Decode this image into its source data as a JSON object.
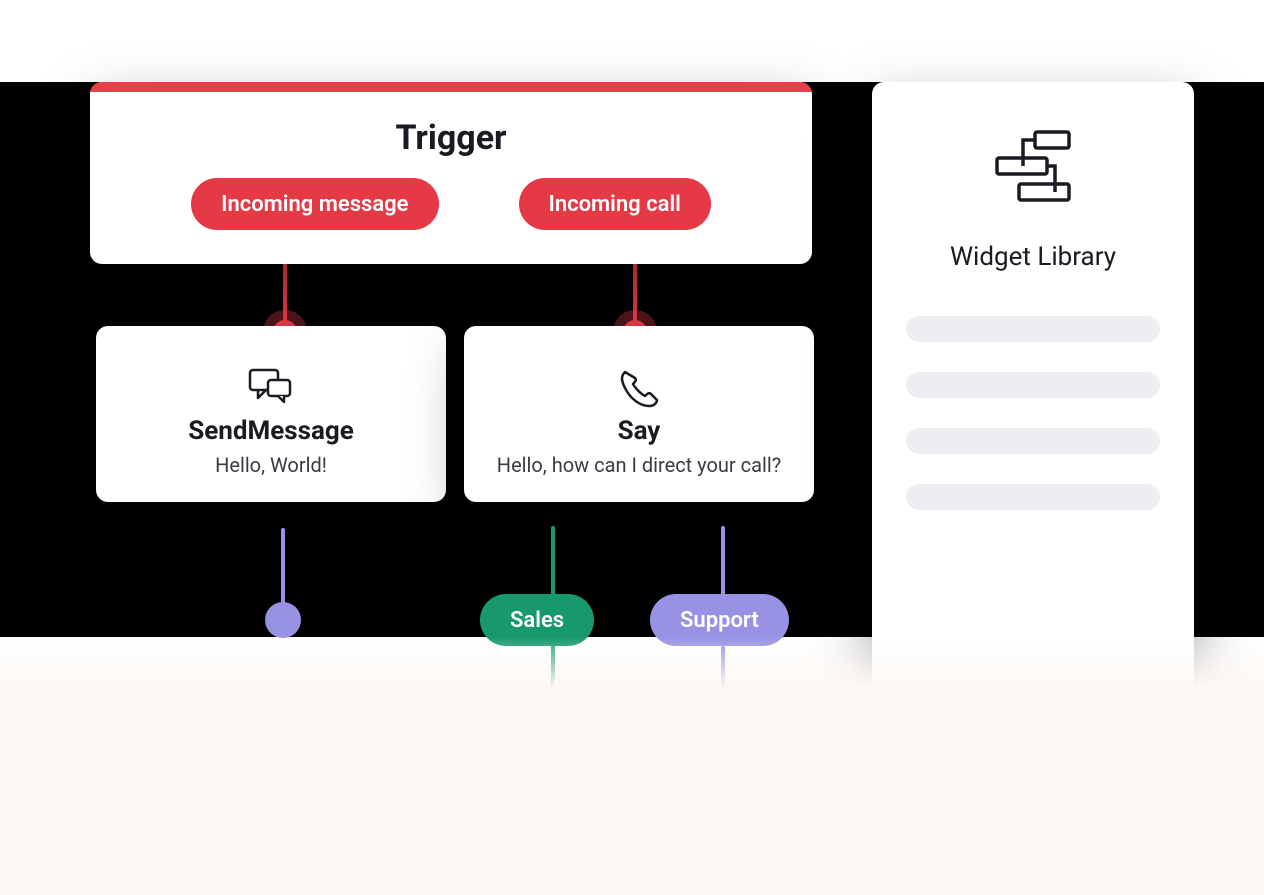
{
  "trigger": {
    "title": "Trigger",
    "pills": {
      "message": "Incoming message",
      "call": "Incoming call"
    }
  },
  "widgets": {
    "sendMessage": {
      "name": "SendMessage",
      "body": "Hello, World!"
    },
    "say": {
      "name": "Say",
      "body": "Hello, how can I direct your call?"
    }
  },
  "outputs": {
    "sales": "Sales",
    "support": "Support"
  },
  "library": {
    "title": "Widget Library"
  },
  "colors": {
    "red": "#e63946",
    "green": "#17996d",
    "violet": "#9792e3",
    "ink": "#1a1a22"
  }
}
